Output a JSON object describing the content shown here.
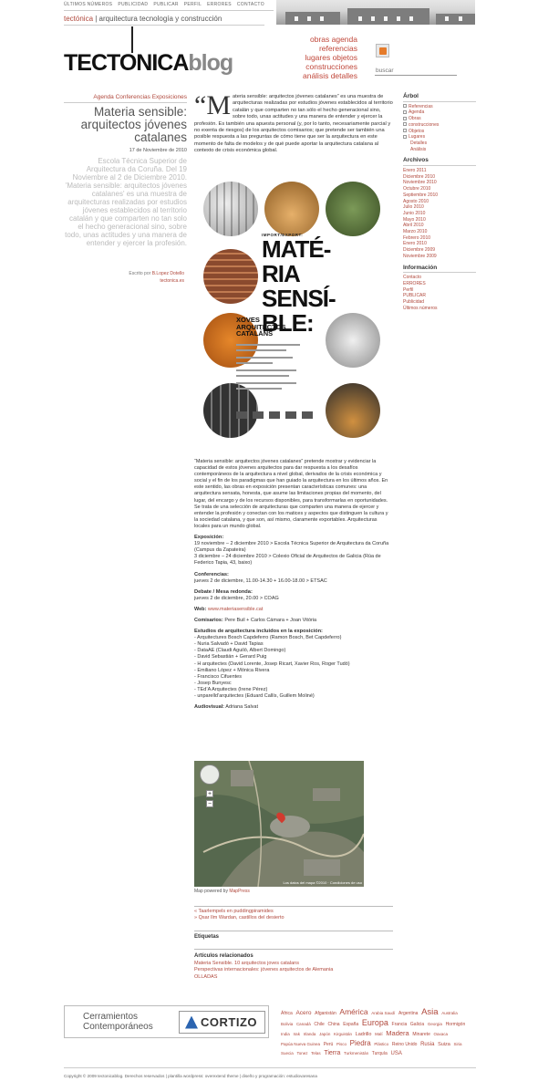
{
  "topnav": [
    "ÚLTIMOS NÚMEROS",
    "PUBLICIDAD",
    "PUBLICAR",
    "PERFIL",
    "ERRORES",
    "CONTACTO"
  ],
  "tagline": {
    "brand": "tectónica",
    "rest": " | arquitectura tecnología y construcción"
  },
  "logo": {
    "main": "TECTONICA",
    "blog": "blog"
  },
  "catnav": [
    "obras agenda",
    "referencias",
    "lugares objetos",
    "construcciones",
    "análisis detalles"
  ],
  "search": {
    "placeholder": "buscar"
  },
  "post": {
    "categories": "Agenda Conferencias Exposiciones",
    "title": "Materia sensible: arquitectos jóvenes catalanes",
    "date": "17 de Noviembre de 2010",
    "excerpt": "Escola Técnica Superior de Arquitectura da Coruña. Del 19 Noviembre al 2 de Diciembre 2010. 'Materia sensible: arquitectos jóvenes catalanes' es una muestra de arquitecturas realizadas por estudios jóvenes establecidos al territorio catalán y que comparten no tan solo el hecho generacional sino, sobre todo, unas actitudes y una manera de entender y ejercer la profesión.",
    "author_prefix": "Escrito por",
    "author": "B.Lopez Dotello",
    "author_site": "tectonica.es",
    "intro_quote": "“M",
    "intro": "ateria sensible: arquitectos jóvenes catalanes” es una muestra de arquitecturas realizadas por estudios jóvenes establecidos al territorio catalán y que comparten no tan sólo el hecho generacional sino, sobre todo, unas actitudes y una manera de entender y ejercer la profesión. Es también una apuesta personal (y, por lo tanto, necesariamente parcial y no exenta de riesgos) de los arquitectos comisarios; que pretende ser también una posible respuesta a las preguntas de cómo tiene que ser la arquitectura en este momento de falta de modelos y de qué puede aportar la arquitectura catalana al contexto de crisis económica global."
  },
  "poster": {
    "import_export": "IMPORT/EXPORT:",
    "title_lines": [
      "MATÉ-",
      "RIA",
      "SENSÍ-",
      "BLE:"
    ],
    "xoves": [
      "XOVES",
      "ARQUITECTOS",
      "CATALÁNS"
    ],
    "colors": {
      "amber": "#c98a3a",
      "dark": "#2a2a2a",
      "green": "#5f7a3e",
      "brick": "#8a4a2e",
      "grey": "#6f6f6f",
      "orange": "#d1741f"
    }
  },
  "article": {
    "para1": "“Materia sensible: arquitectos jóvenes catalanes” pretende mostrar y evidenciar la capacidad de estos jóvenes arquitectos para dar respuesta a los desafíos contemporáneos de la arquitectura a nivel global, derivados de la crisis económica y social y el fin de los paradigmas que han guiado la arquitectura en los últimos años. En este sentido, las obras en exposición presentan características comunes: una arquitectura sensata, honesta, que asume las limitaciones propias del momento, del lugar, del encargo y de los recursos disponibles, para transformarlas en oportunidades. Se trata de una selección de arquitecturas que comparten una manera de ejercer y entender la profesión y conectan con los matices y aspectos que distinguen la cultura y la sociedad catalana, y que son, así mismo, claramente exportables. Arquitecturas locales para un mundo global.",
    "exposicion_h": "Exposición:",
    "exposicion": [
      "19 noviembre – 2 diciembre 2010  >  Escola Técnica Superior de Arquitectura da Coruña (Campus da Zapateira)",
      "3 diciembre – 24 diciembre 2010  >  Colexio Oficial de Arquitectos de Galicia (Rúa de Federico Tapia, 43, baixo)"
    ],
    "conferencias_h": "Conferencias:",
    "conferencias": "jueves 2 de diciembre, 11.00-14.30 + 16.00-18.00  >  ETSAC",
    "debate_h": "Debate / Mesa redonda:",
    "debate": "jueves 2 de diciembre, 20.00  >  COAG",
    "web_h": "Web:",
    "web": "www.materiasensible.cat",
    "comisarios_h": "Comisarios:",
    "comisarios": "Pere Buil + Carlos Cámara + Joan Vitória",
    "estudios_h": "Estudios de arquitectura incluidos en la exposición:",
    "estudios": [
      "- Arquitectures Bosch Capdeferro (Ramon Bosch, Bet Capdeferro)",
      "- Nuria Salvadó + David Tapias",
      "- DataAE (Claudi Aguiló, Albert Domingo)",
      "- David Sebastián + Gerard Puig",
      "- H arquitectes (David Lorente, Josep Ricart, Xavier Ros, Roger Tudó)",
      "- Emiliano López + Mónica Rivera",
      "- Francisco Cifuentes",
      "- Josep Bunyesc",
      "- TEd’A Arquitectes (Irene Pérez)",
      "- unparelld’arquitectes (Eduard Callís, Guillem Moliné)"
    ],
    "audiovisual_h": "Audiovisual:",
    "audiovisual": "Adriana Salvat"
  },
  "map": {
    "caption_prefix": "Map powered by",
    "caption_link": "MapPress",
    "copyright": "Los datos del mapa ©2010 · Condiciones de uso"
  },
  "prevnext": [
    "« Taarlempels en puddingpiramides",
    "» Qsar Ilm Wardan, castillos del desierto"
  ],
  "tags_label": "Etiquetas",
  "related": {
    "heading": "Artículos relacionados",
    "items": [
      "Materia Sensible. 10 arquitectos joves catalans",
      "Perspectivas internacionales: jóvenes arquitectos de Alemania",
      "OLLADAS"
    ]
  },
  "sidebar": {
    "arbol_h": "Árbol",
    "arbol": [
      "Referencias",
      "Agenda",
      "Obras",
      "construcciones",
      "Objetos",
      "Lugares"
    ],
    "arbol_sub": [
      "Detalles",
      "Análisis"
    ],
    "archivos_h": "Archivos",
    "archivos": [
      "Enero 2011",
      "Diciembre 2010",
      "Noviembre 2010",
      "Octubre 2010",
      "Septiembre 2010",
      "Agosto 2010",
      "Julio 2010",
      "Junio 2010",
      "Mayo 2010",
      "Abril 2010",
      "Marzo 2010",
      "Febrero 2010",
      "Enero 2010",
      "Diciembre 2009",
      "Noviembre 2009"
    ],
    "info_h": "Información",
    "info": [
      "Contacto",
      "ERRORES",
      "Perfil",
      "PUBLICAR",
      "Publicidad",
      "Últimos números"
    ]
  },
  "sponsor": {
    "text1": "Cerramientos",
    "text2": "Contemporáneos",
    "brand": "CORTIZO"
  },
  "tagcloud": [
    {
      "t": "África",
      "s": 5
    },
    {
      "t": "Acero",
      "s": 6.5
    },
    {
      "t": "Afganistán",
      "s": 5
    },
    {
      "t": "América",
      "s": 8.5
    },
    {
      "t": "Arabia Saudí",
      "s": 4.5
    },
    {
      "t": "Argentina",
      "s": 5
    },
    {
      "t": "Asia",
      "s": 9.5
    },
    {
      "t": "Australia",
      "s": 4.5
    },
    {
      "t": "Bolivia",
      "s": 4.5
    },
    {
      "t": "Canadá",
      "s": 4.5
    },
    {
      "t": "Chile",
      "s": 5
    },
    {
      "t": "China",
      "s": 5
    },
    {
      "t": "España",
      "s": 5
    },
    {
      "t": "Europa",
      "s": 9
    },
    {
      "t": "Francia",
      "s": 5
    },
    {
      "t": "Galicia",
      "s": 5
    },
    {
      "t": "Georgia",
      "s": 4.5
    },
    {
      "t": "Hormigón",
      "s": 5
    },
    {
      "t": "India",
      "s": 4.5
    },
    {
      "t": "Irak",
      "s": 4.5
    },
    {
      "t": "Irlanda",
      "s": 4.5
    },
    {
      "t": "Japón",
      "s": 4.5
    },
    {
      "t": "Kirguistán",
      "s": 4.5
    },
    {
      "t": "Ladrillo",
      "s": 5.5
    },
    {
      "t": "Malí",
      "s": 4.5
    },
    {
      "t": "Madera",
      "s": 7.5
    },
    {
      "t": "Minarete",
      "s": 5
    },
    {
      "t": "Oaxaca",
      "s": 4.5
    },
    {
      "t": "Papúa Nueva Guinea",
      "s": 4.5
    },
    {
      "t": "Perú",
      "s": 5
    },
    {
      "t": "Pisco",
      "s": 4.5
    },
    {
      "t": "Piedra",
      "s": 8
    },
    {
      "t": "Plástico",
      "s": 4.5
    },
    {
      "t": "Reino Unido",
      "s": 5
    },
    {
      "t": "Rusia",
      "s": 6
    },
    {
      "t": "Suiza",
      "s": 5.5
    },
    {
      "t": "Siria",
      "s": 4.5
    },
    {
      "t": "Suecia",
      "s": 4.5
    },
    {
      "t": "Tonez",
      "s": 4.5
    },
    {
      "t": "Telas",
      "s": 4.5
    },
    {
      "t": "Tierra",
      "s": 7
    },
    {
      "t": "Turkmenistán",
      "s": 4.5
    },
    {
      "t": "Turquía",
      "s": 5
    },
    {
      "t": "USA",
      "s": 6
    }
  ],
  "footer": "Copyright © 2009 tectonicablog. Derechos reservados | plantilla wordpress: overextend theme | diseño y programación: estudiovaresana"
}
